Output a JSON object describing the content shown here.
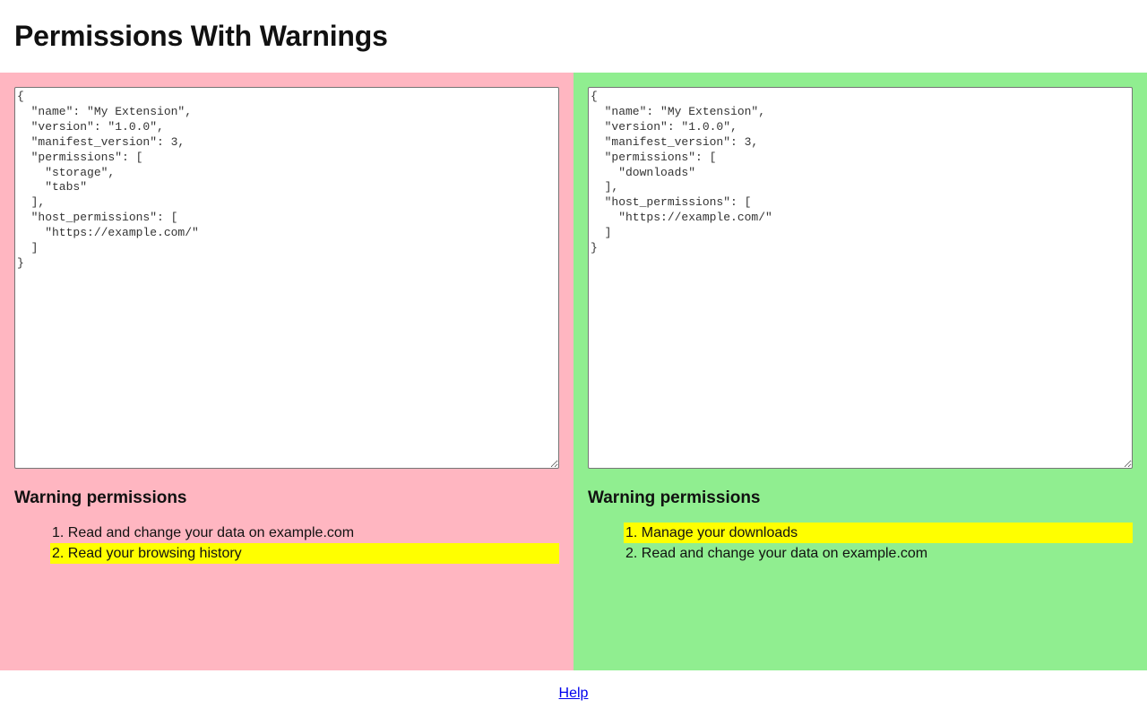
{
  "page": {
    "title": "Permissions With Warnings"
  },
  "panels": [
    {
      "background": "#ffb6c1",
      "manifest": "{\n  \"name\": \"My Extension\",\n  \"version\": \"1.0.0\",\n  \"manifest_version\": 3,\n  \"permissions\": [\n    \"storage\",\n    \"tabs\"\n  ],\n  \"host_permissions\": [\n    \"https://example.com/\"\n  ]\n}",
      "heading": "Warning permissions",
      "warnings": [
        {
          "number": "1.",
          "text": "Read and change your data on example.com",
          "highlighted": false
        },
        {
          "number": "2.",
          "text": "Read your browsing history",
          "highlighted": true
        }
      ]
    },
    {
      "background": "#90ee90",
      "manifest": "{\n  \"name\": \"My Extension\",\n  \"version\": \"1.0.0\",\n  \"manifest_version\": 3,\n  \"permissions\": [\n    \"downloads\"\n  ],\n  \"host_permissions\": [\n    \"https://example.com/\"\n  ]\n}",
      "heading": "Warning permissions",
      "warnings": [
        {
          "number": "1.",
          "text": "Manage your downloads",
          "highlighted": true
        },
        {
          "number": "2.",
          "text": "Read and change your data on example.com",
          "highlighted": false
        }
      ]
    }
  ],
  "highlight_color": "#ffff00",
  "footer": {
    "help_label": "Help"
  }
}
